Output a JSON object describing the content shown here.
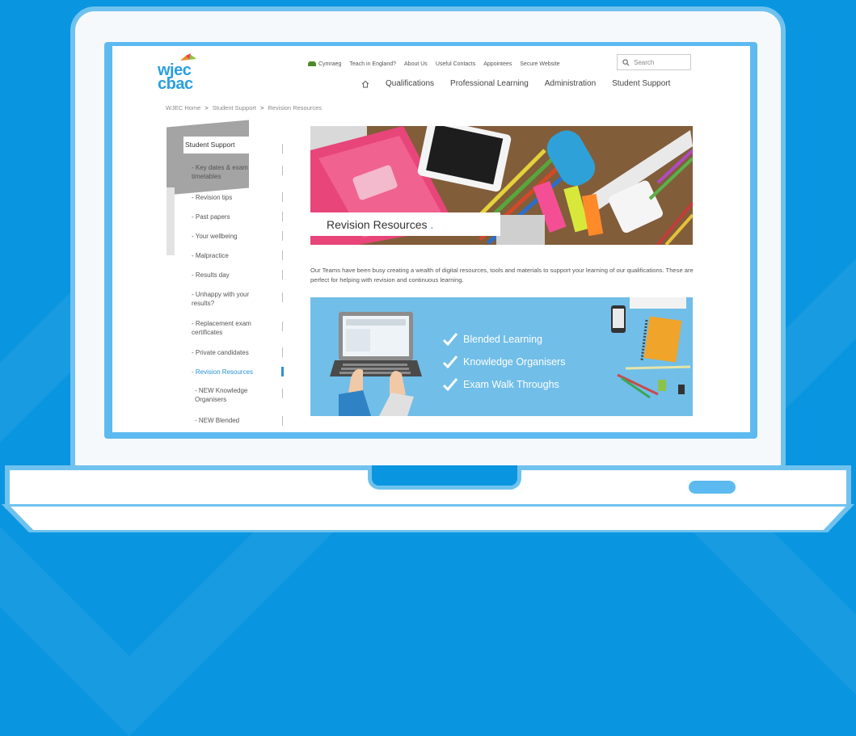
{
  "header": {
    "logo_line1": "wjec",
    "logo_line2": "cbac",
    "top_links": [
      "Cymraeg",
      "Teach in England?",
      "About Us",
      "Useful Contacts",
      "Appointees",
      "Secure Website"
    ],
    "search_placeholder": "Search",
    "main_nav": [
      "Qualifications",
      "Professional Learning",
      "Administration",
      "Student Support"
    ]
  },
  "breadcrumb": {
    "items": [
      "WJEC Home",
      "Student Support",
      "Revision Resources"
    ],
    "separator": ">"
  },
  "sidebar": {
    "title": "Student Support",
    "items": [
      {
        "label": "- Key dates & exam timetables",
        "active": false
      },
      {
        "label": "- Revision tips",
        "active": false
      },
      {
        "label": "- Past papers",
        "active": false
      },
      {
        "label": "- Your wellbeing",
        "active": false
      },
      {
        "label": "- Malpractice",
        "active": false
      },
      {
        "label": "- Results day",
        "active": false
      },
      {
        "label": "- Unhappy with your results?",
        "active": false
      },
      {
        "label": "- Replacement exam certificates",
        "active": false
      },
      {
        "label": "- Private candidates",
        "active": false
      },
      {
        "label": "- Revision Resources",
        "active": true
      },
      {
        "label": "- NEW Knowledge Organisers",
        "active": false
      },
      {
        "label": "- NEW Blended",
        "active": false
      }
    ]
  },
  "hero": {
    "title": "Revision Resources",
    "title_dot": "."
  },
  "intro": "Our Teams have been busy creating a wealth of digital resources, tools and materials to support your learning of our qualifications. These are perfect for helping with revision and continuous learning.",
  "banner": {
    "items": [
      "Blended Learning",
      "Knowledge Organisers",
      "Exam Walk Throughs"
    ]
  },
  "colors": {
    "background": "#0a95e0",
    "accent": "#2b93d6",
    "banner": "#71bee8",
    "laptop_frame": "#6fc2ee"
  }
}
